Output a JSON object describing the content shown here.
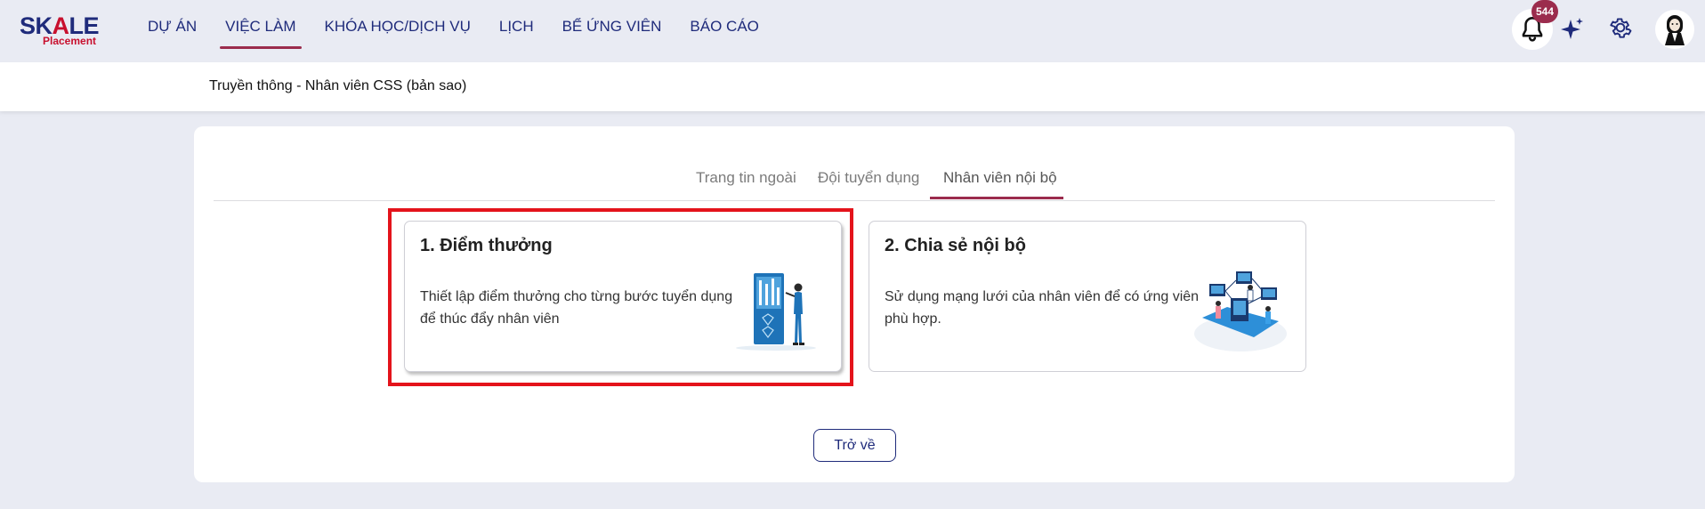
{
  "brand": {
    "logo_main_pre": "SK",
    "logo_main_a": "A",
    "logo_main_post": "LE",
    "logo_sub": "Placement"
  },
  "nav": {
    "items": [
      {
        "label": "DỰ ÁN",
        "active": false
      },
      {
        "label": "VIỆC LÀM",
        "active": true
      },
      {
        "label": "KHÓA HỌC/DỊCH VỤ",
        "active": false
      },
      {
        "label": "LỊCH",
        "active": false
      },
      {
        "label": "BỂ ỨNG VIÊN",
        "active": false
      },
      {
        "label": "BÁO CÁO",
        "active": false
      }
    ]
  },
  "header_actions": {
    "notification_count": "544",
    "icons": [
      "bell-icon",
      "sparkle-icon",
      "gear-icon",
      "avatar"
    ]
  },
  "subheader": {
    "title": "Truyền thông - Nhân viên CSS (bản sao)"
  },
  "tabs": [
    {
      "label": "Trang tin ngoài",
      "active": false
    },
    {
      "label": "Đội tuyển dụng",
      "active": false
    },
    {
      "label": "Nhân viên nội bộ",
      "active": true
    }
  ],
  "cards": [
    {
      "title": "1. Điểm thưởng",
      "description": "Thiết lập điểm thưởng cho từng bước tuyển dụng để thúc đẩy nhân viên",
      "highlighted": true
    },
    {
      "title": "2. Chia sẻ nội bộ",
      "description": "Sử dụng mạng lưới của nhân viên để có ứng viên phù hợp.",
      "highlighted": false
    }
  ],
  "footer": {
    "back_label": "Trở về"
  },
  "colors": {
    "primary": "#1f2b7b",
    "accent": "#9b2c4d",
    "highlight": "#e4131b",
    "background": "#e9ebf3"
  }
}
